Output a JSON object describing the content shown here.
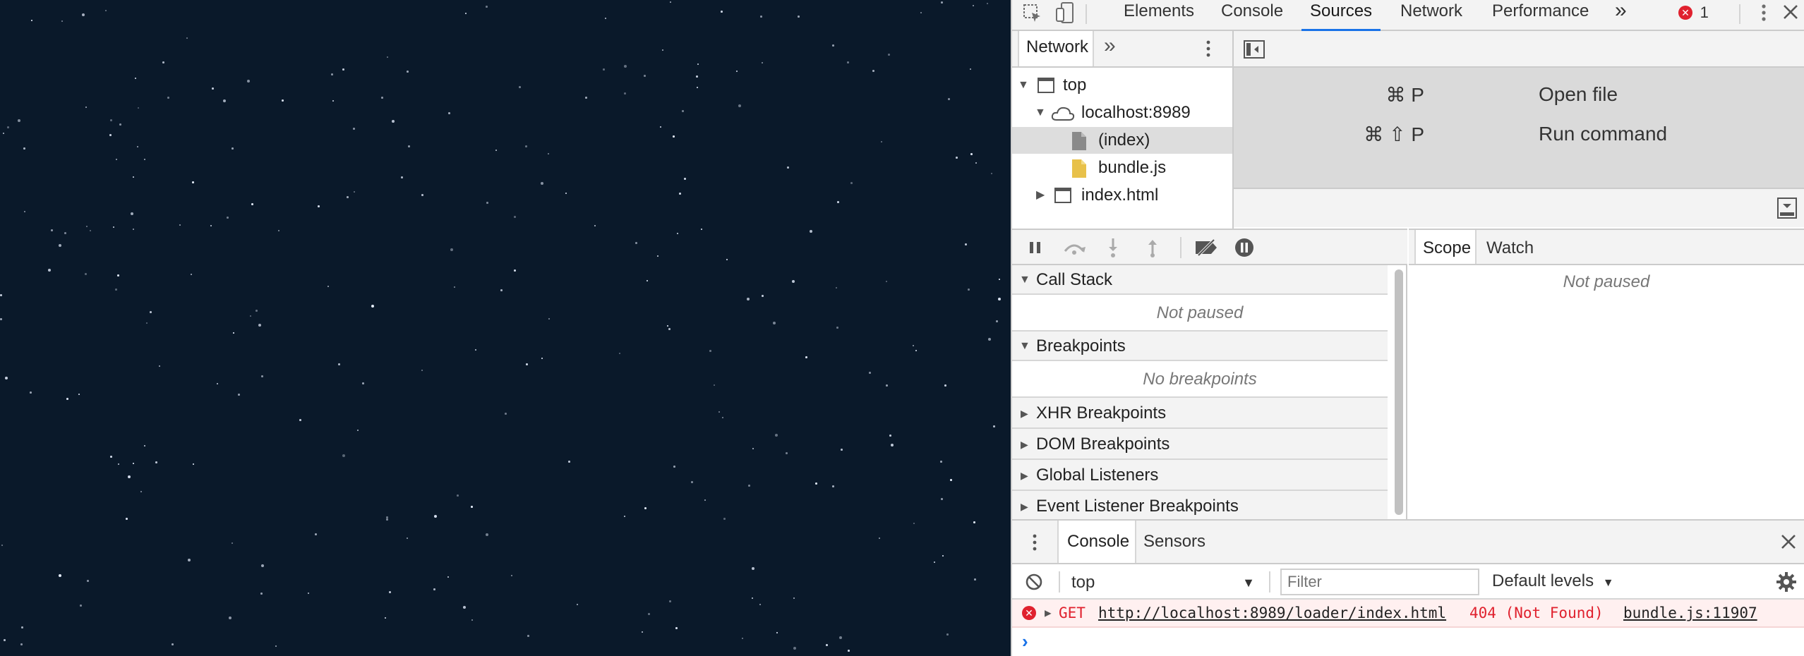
{
  "devtools": {
    "tabs": [
      "Elements",
      "Console",
      "Sources",
      "Network",
      "Performance"
    ],
    "more_tabs": "»",
    "error_count": "1",
    "navigator_tab": "Network",
    "navigator_more": "»",
    "tree": {
      "top": "top",
      "host": "localhost:8989",
      "index": "(index)",
      "bundle": "bundle.js",
      "index_html": "index.html"
    },
    "shortcuts": [
      {
        "keys": "⌘ P",
        "label": "Open file"
      },
      {
        "keys": "⌘ ⇧ P",
        "label": "Run command"
      }
    ],
    "debugger": {
      "call_stack": "Call Stack",
      "call_stack_status": "Not paused",
      "breakpoints": "Breakpoints",
      "breakpoints_status": "No breakpoints",
      "xhr": "XHR Breakpoints",
      "dom": "DOM Breakpoints",
      "global": "Global Listeners",
      "event": "Event Listener Breakpoints"
    },
    "scope_tabs": [
      "Scope",
      "Watch"
    ],
    "scope_status": "Not paused",
    "drawer_tabs": [
      "Console",
      "Sensors"
    ],
    "console": {
      "context": "top",
      "filter_placeholder": "Filter",
      "levels": "Default levels",
      "error": {
        "method": "GET",
        "url": "http://localhost:8989/loader/index.html",
        "status": "404 (Not Found)",
        "source": "bundle.js:11907"
      },
      "prompt": "›"
    },
    "colors": {
      "accent": "#1a73e8",
      "error": "#e0212e",
      "canvas_bg": "#0a192a"
    }
  }
}
